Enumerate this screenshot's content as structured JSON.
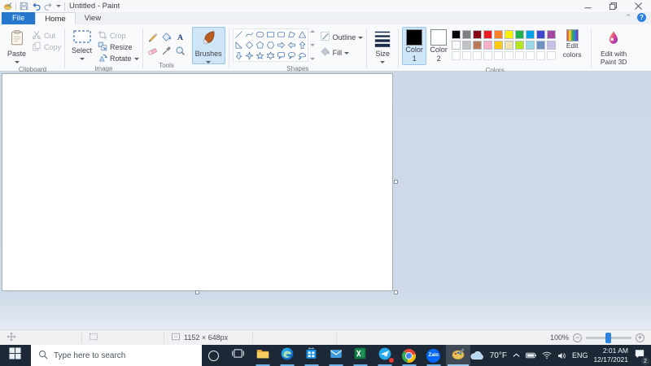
{
  "window": {
    "title": "Untitled - Paint"
  },
  "tabs": {
    "file": "File",
    "home": "Home",
    "view": "View"
  },
  "help_glyph": "?",
  "ribbon": {
    "clipboard": {
      "group_label": "Clipboard",
      "paste": "Paste",
      "cut": "Cut",
      "copy": "Copy"
    },
    "image": {
      "group_label": "Image",
      "select": "Select",
      "crop": "Crop",
      "resize": "Resize",
      "rotate": "Rotate"
    },
    "tools": {
      "group_label": "Tools",
      "items": [
        "pencil",
        "fill",
        "text",
        "eraser",
        "picker",
        "magnifier"
      ]
    },
    "brushes": {
      "label": "Brushes"
    },
    "shapes": {
      "group_label": "Shapes",
      "outline": "Outline",
      "fill": "Fill",
      "items": [
        "line",
        "curve",
        "ellipse",
        "rectangle",
        "rounded-rectangle",
        "polygon",
        "triangle",
        "right-triangle",
        "diamond",
        "pentagon",
        "hexagon",
        "right-arrow",
        "left-arrow",
        "up-arrow",
        "down-arrow",
        "four-point-star",
        "five-point-star",
        "six-point-star",
        "rounded-callout",
        "oval-callout",
        "cloud-callout"
      ]
    },
    "size": {
      "label": "Size"
    },
    "colors": {
      "group_label": "Colors",
      "color1_label": "Color 1",
      "color2_label": "Color 2",
      "color1_value": "#000000",
      "color2_value": "#FFFFFF",
      "edit_colors": "Edit colors",
      "edit_paint3d": "Edit with Paint 3D",
      "palette_row1": [
        "#000000",
        "#7F7F7F",
        "#880015",
        "#ED1C24",
        "#FF7F27",
        "#FFF200",
        "#22B14C",
        "#00A2E8",
        "#3F48CC",
        "#A349A4"
      ],
      "palette_row2": [
        "#FFFFFF",
        "#C3C3C3",
        "#B97A57",
        "#FFAEC9",
        "#FFC90E",
        "#EFE4B0",
        "#B5E61D",
        "#99D9EA",
        "#7092BE",
        "#C8BFE7"
      ],
      "empty_cells": 10
    }
  },
  "statusbar": {
    "image_size": "1152 × 648px",
    "zoom_level": "100%"
  },
  "taskbar": {
    "search_placeholder": "Type here to search",
    "apps": [
      {
        "name": "task-view",
        "running": false,
        "active": false,
        "badge": false
      },
      {
        "name": "file-explorer",
        "running": true,
        "active": false,
        "badge": false
      },
      {
        "name": "edge",
        "running": true,
        "active": false,
        "badge": false
      },
      {
        "name": "store",
        "running": true,
        "active": false,
        "badge": false
      },
      {
        "name": "mail",
        "running": true,
        "active": false,
        "badge": false
      },
      {
        "name": "excel",
        "running": true,
        "active": false,
        "badge": false
      },
      {
        "name": "messenger",
        "running": true,
        "active": false,
        "badge": true
      },
      {
        "name": "chrome",
        "running": true,
        "active": false,
        "badge": false
      },
      {
        "name": "zalo",
        "running": true,
        "active": false,
        "badge": false
      },
      {
        "name": "paint",
        "running": true,
        "active": true,
        "badge": false
      }
    ],
    "tray": {
      "temperature": "70°F",
      "language": "ENG",
      "time": "2:01 AM",
      "date": "12/17/2021",
      "notification_count": "2"
    }
  }
}
